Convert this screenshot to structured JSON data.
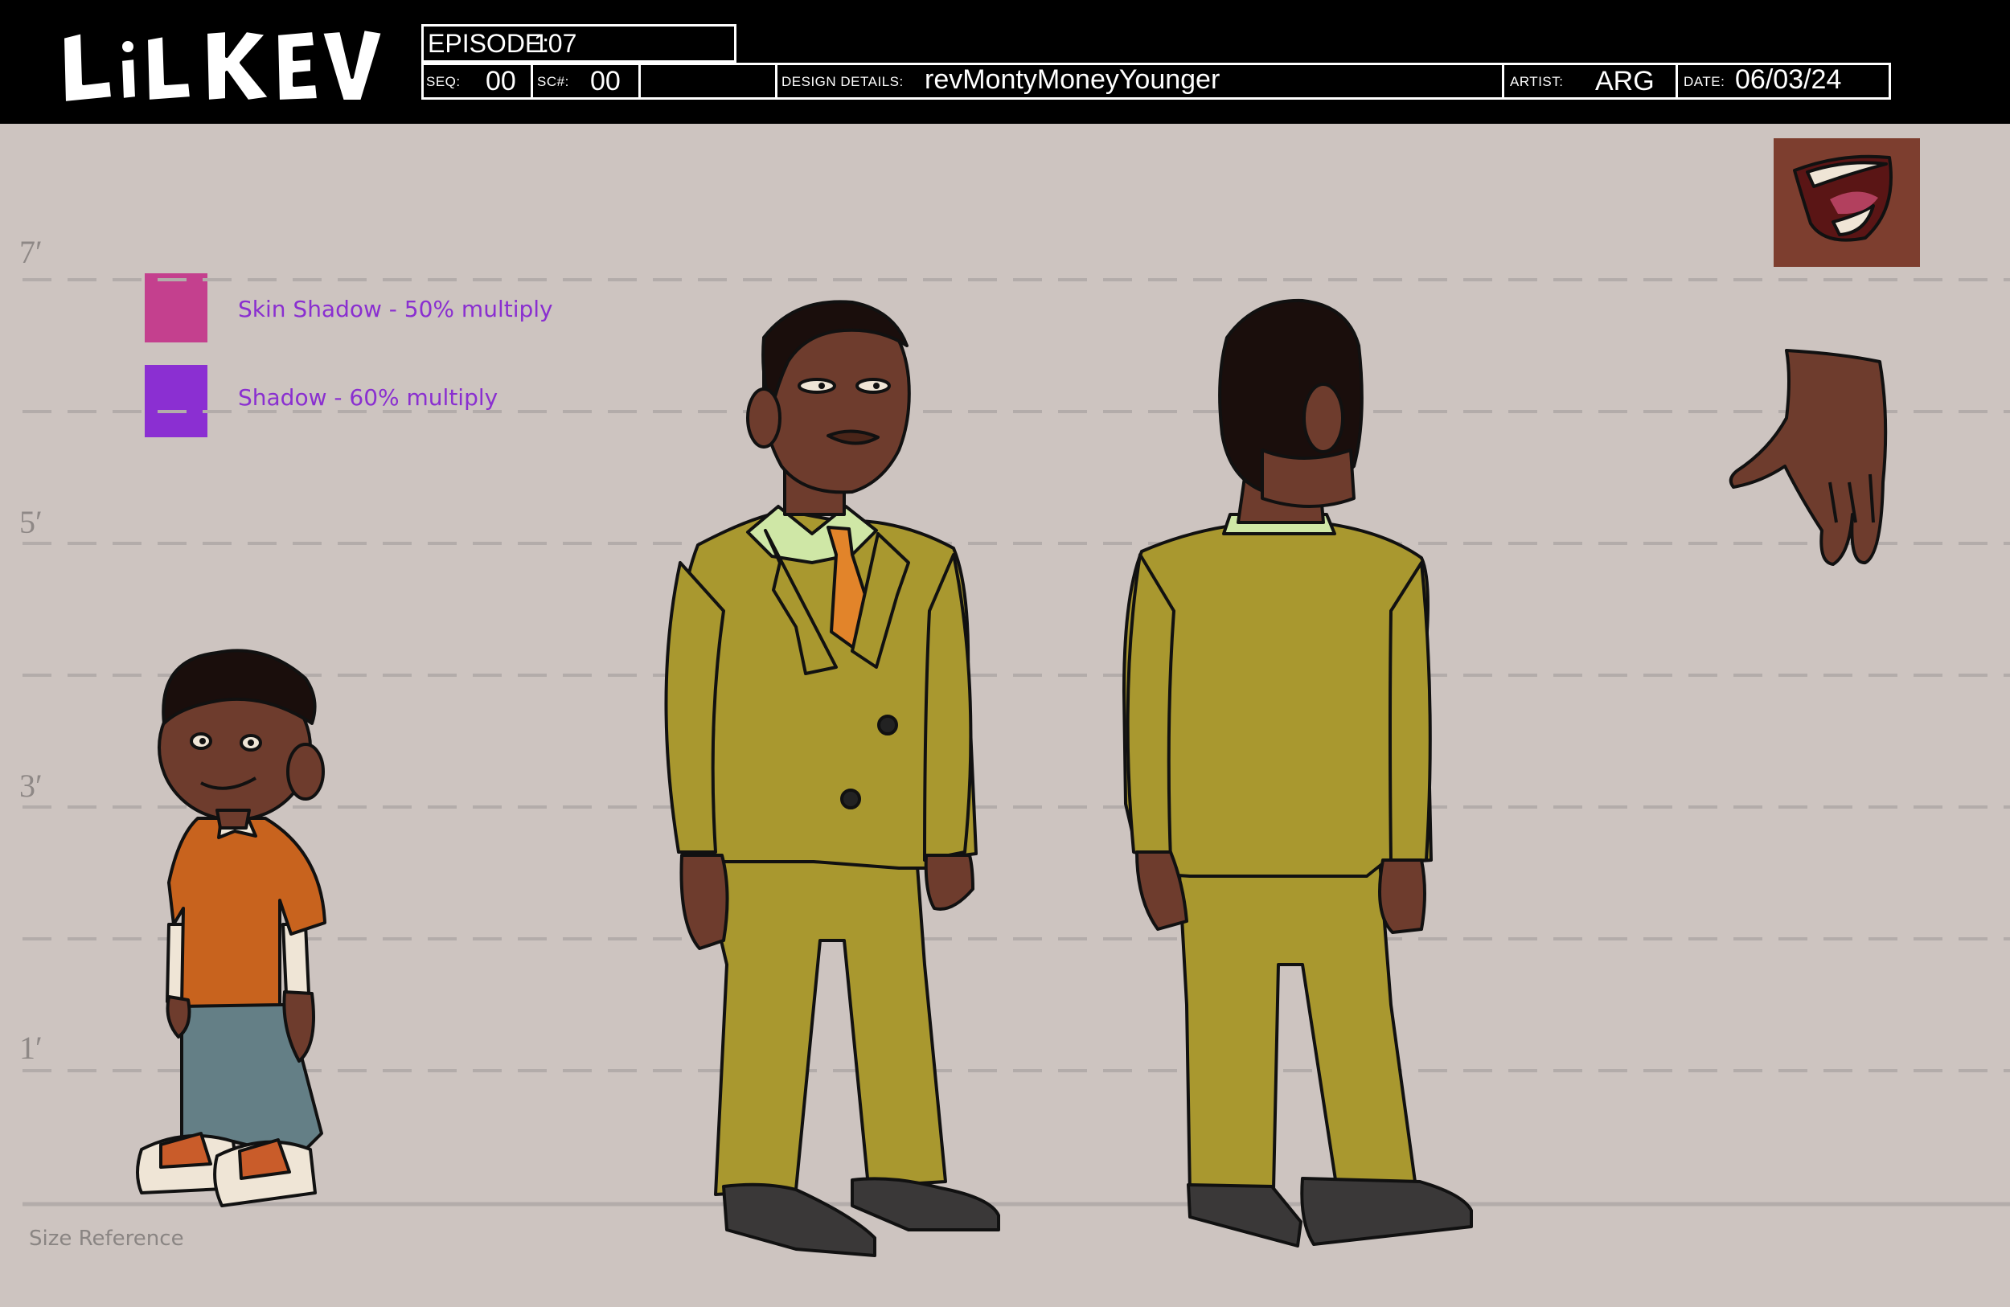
{
  "header": {
    "logo_text": "LiL KEV",
    "episode_label": "EPISODE:",
    "episode_value": "107",
    "seq_label": "SEQ:",
    "seq_value": "00",
    "sc_label": "SC#:",
    "sc_value": "00",
    "design_label": "DESIGN DETAILS:",
    "design_value": "revMontyMoneyYounger",
    "artist_label": "ARTIST:",
    "artist_value": "ARG",
    "date_label": "DATE:",
    "date_value": "06/03/24"
  },
  "height_marks": [
    "7′",
    "5′",
    "3′",
    "1′"
  ],
  "swatches": [
    {
      "label": "Skin Shadow - 50% multiply",
      "color": "#c4408e"
    },
    {
      "label": "Shadow - 60% multiply",
      "color": "#8b2fd2"
    }
  ],
  "size_reference_label": "Size Reference",
  "colors": {
    "background": "#cdc4c0",
    "guide_line": "#b3acaa",
    "suit": "#a9982f",
    "suit_shadow": "#8a7a24",
    "skin": "#6e3c2d",
    "skin_dark": "#4a2519",
    "hair": "#1a0e0c",
    "shirt": "#cfe7a6",
    "tie": "#e2842a",
    "shoe": "#3a3838",
    "kid_shirt": "#c8631e",
    "kid_jeans": "#647f86"
  }
}
